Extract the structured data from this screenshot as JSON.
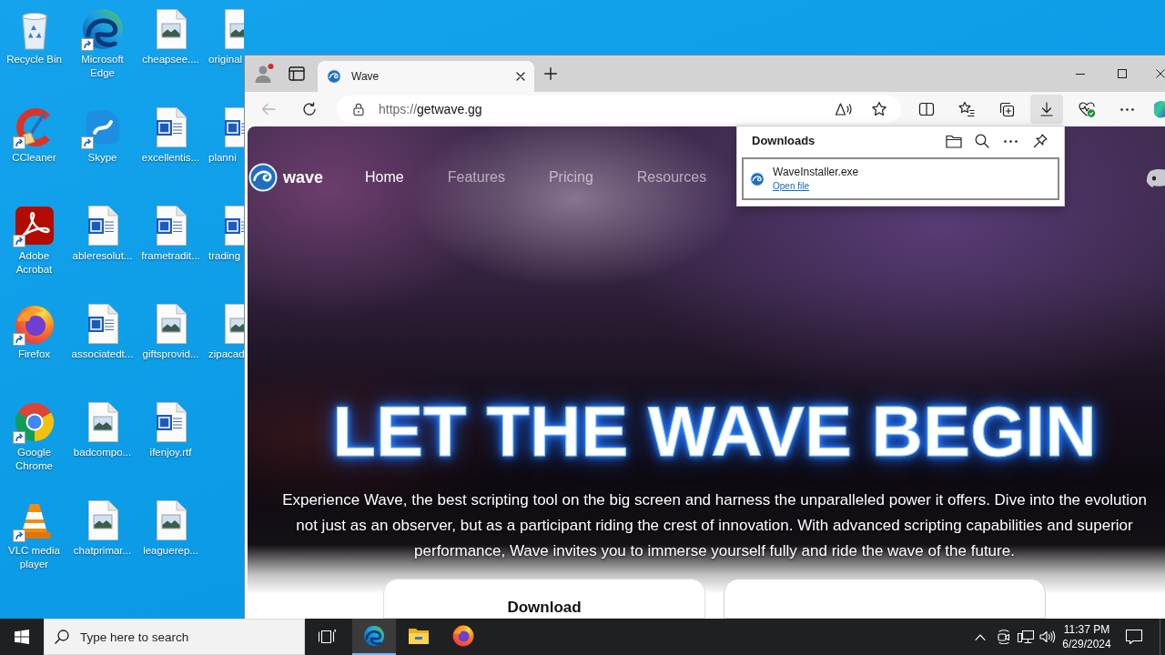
{
  "desktop": {
    "columns": [
      [
        {
          "label": "Recycle Bin",
          "kind": "recycle-bin",
          "shortcut": false
        },
        {
          "label": "CCleaner",
          "kind": "ccleaner",
          "shortcut": true
        },
        {
          "label": "Adobe Acrobat",
          "kind": "acrobat",
          "shortcut": true
        },
        {
          "label": "Firefox",
          "kind": "firefox",
          "shortcut": true
        },
        {
          "label": "Google Chrome",
          "kind": "chrome",
          "shortcut": true
        },
        {
          "label": "VLC media player",
          "kind": "vlc",
          "shortcut": true
        }
      ],
      [
        {
          "label": "Microsoft Edge",
          "kind": "edge",
          "shortcut": true
        },
        {
          "label": "Skype",
          "kind": "skype",
          "shortcut": true
        },
        {
          "label": "ableresolut...",
          "kind": "word",
          "shortcut": false
        },
        {
          "label": "associatedt...",
          "kind": "word",
          "shortcut": false
        },
        {
          "label": "badcompo...",
          "kind": "image",
          "shortcut": false
        },
        {
          "label": "chatprimar...",
          "kind": "image",
          "shortcut": false
        }
      ],
      [
        {
          "label": "cheapsee....",
          "kind": "image",
          "shortcut": false
        },
        {
          "label": "excellentis...",
          "kind": "word",
          "shortcut": false
        },
        {
          "label": "frametradit...",
          "kind": "word",
          "shortcut": false
        },
        {
          "label": "giftsprovid...",
          "kind": "image",
          "shortcut": false
        },
        {
          "label": "ifenjoy.rtf",
          "kind": "word",
          "shortcut": false
        },
        {
          "label": "leaguerep...",
          "kind": "image",
          "shortcut": false
        }
      ],
      [
        {
          "label": "original",
          "kind": "image",
          "shortcut": false
        },
        {
          "label": "planni",
          "kind": "word",
          "shortcut": false
        },
        {
          "label": "trading",
          "kind": "word",
          "shortcut": false
        },
        {
          "label": "zipacad",
          "kind": "image",
          "shortcut": false
        }
      ]
    ]
  },
  "browser": {
    "tabs": [
      {
        "title": "Wave",
        "selected": true
      }
    ],
    "nav_buttons": [
      {
        "kind": "back",
        "disabled": true
      },
      {
        "kind": "refresh",
        "disabled": false
      }
    ],
    "address_bar": {
      "scheme": "https://",
      "host": "getwave.gg"
    },
    "toolbar_buttons": [
      {
        "kind": "split-screen",
        "selected": false
      },
      {
        "kind": "favorites",
        "selected": false
      },
      {
        "kind": "collections",
        "selected": false
      },
      {
        "kind": "downloads",
        "selected": true
      },
      {
        "kind": "browser-essentials",
        "selected": false
      },
      {
        "kind": "more",
        "selected": false
      }
    ],
    "downloads_panel": {
      "title": "Downloads",
      "items": [
        {
          "file_name": "WaveInstaller.exe",
          "action": "Open file",
          "selected": true
        }
      ]
    },
    "page": {
      "logo_text": "wave",
      "nav_links": [
        {
          "label": "Home",
          "selected": true
        },
        {
          "label": "Features",
          "selected": false
        },
        {
          "label": "Pricing",
          "selected": false
        },
        {
          "label": "Resources",
          "selected": false
        }
      ],
      "headline": "LET THE WAVE BEGIN",
      "intro": "Experience Wave, the best scripting tool on the big screen and harness the unparalleled power it offers. Dive into the evolution not just as an observer, but as a participant riding the crest of innovation. With advanced scripting capabilities and superior performance, Wave invites you to immerse yourself fully and ride the wave of the future.",
      "cards": [
        {
          "kind": "titled",
          "title": "Download"
        },
        {
          "kind": "blank"
        }
      ]
    }
  },
  "taskbar": {
    "search": {
      "placeholder": "Type here to search"
    },
    "apps": [
      {
        "kind": "edge",
        "selected": true
      },
      {
        "kind": "file-explorer",
        "selected": false
      },
      {
        "kind": "firefox",
        "selected": false
      }
    ],
    "clock": {
      "time": "11:37 PM",
      "date": "6/29/2024"
    }
  }
}
